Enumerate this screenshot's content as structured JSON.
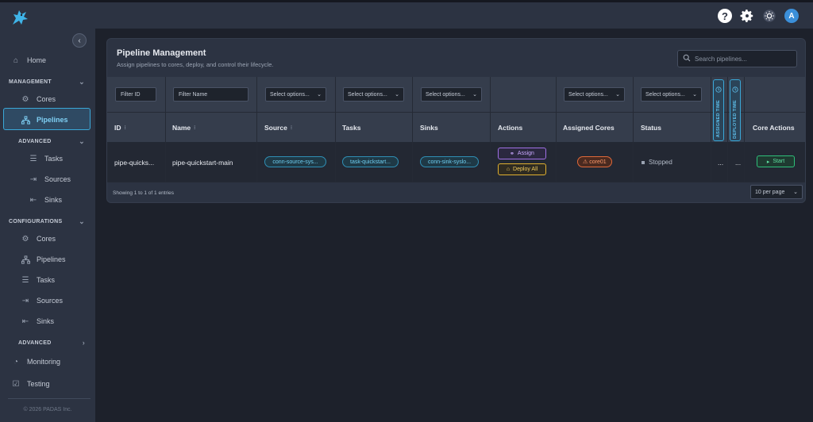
{
  "topbar": {
    "icons": [
      "help-icon",
      "gear-icon",
      "sun-icon"
    ],
    "help_glyph": "?",
    "avatar_letter": "A"
  },
  "sidebar": {
    "home": "Home",
    "management_label": "MANAGEMENT",
    "management_items": [
      {
        "label": "Cores",
        "icon": "gear-icon"
      },
      {
        "label": "Pipelines",
        "icon": "pipeline-icon",
        "active": true
      }
    ],
    "advanced_label": "ADVANCED",
    "advanced_items": [
      {
        "label": "Tasks",
        "icon": "list-icon"
      },
      {
        "label": "Sources",
        "icon": "source-icon"
      },
      {
        "label": "Sinks",
        "icon": "sink-icon"
      }
    ],
    "configurations_label": "CONFIGURATIONS",
    "configuration_items": [
      {
        "label": "Cores",
        "icon": "gear-icon"
      },
      {
        "label": "Pipelines",
        "icon": "pipeline-icon"
      },
      {
        "label": "Tasks",
        "icon": "list-icon"
      },
      {
        "label": "Sources",
        "icon": "source-icon"
      },
      {
        "label": "Sinks",
        "icon": "sink-icon"
      }
    ],
    "advanced2_label": "ADVANCED",
    "monitoring": "Monitoring",
    "testing": "Testing",
    "copyright": "© 2026 PADAS Inc."
  },
  "panel": {
    "title": "Pipeline Management",
    "subtitle": "Assign pipelines to cores, deploy, and control their lifecycle.",
    "search_placeholder": "Search pipelines..."
  },
  "table": {
    "filters": {
      "id_placeholder": "Filter ID",
      "name_placeholder": "Filter Name",
      "select_placeholder": "Select options..."
    },
    "headers": {
      "id": "ID",
      "name": "Name",
      "source": "Source",
      "tasks": "Tasks",
      "sinks": "Sinks",
      "actions": "Actions",
      "assigned_cores": "Assigned Cores",
      "status": "Status",
      "assigned_time": "ASSIGNED TIME",
      "deployed_time": "DEPLOYED TIME",
      "core_actions": "Core Actions"
    },
    "rows": [
      {
        "id": "pipe-quicks...",
        "name": "pipe-quickstart-main",
        "source": "conn-source-sys...",
        "task": "task-quickstart...",
        "sink": "conn-sink-syslo...",
        "assign_label": "Assign",
        "deploy_label": "Deploy All",
        "core": "core01",
        "status": "Stopped",
        "assigned_time": "...",
        "deployed_time": "...",
        "start_label": "Start"
      }
    ],
    "entries_text": "Showing 1 to 1 of 1 entries",
    "per_page": "10 per page"
  },
  "colors": {
    "accent": "#3aa8d8",
    "assign": "#a070e6",
    "deploy": "#e0b030",
    "core_badge": "#e0693a",
    "start": "#2ec07a"
  }
}
